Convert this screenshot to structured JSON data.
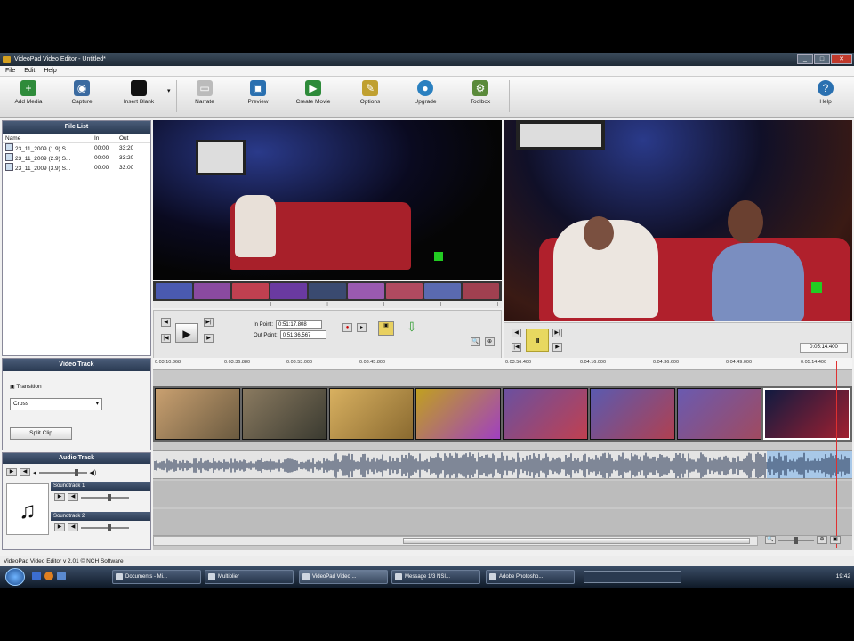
{
  "window": {
    "title": "VideoPad Video Editor - Untitled*"
  },
  "menu": [
    "File",
    "Edit",
    "Help"
  ],
  "toolbar": [
    {
      "label": "Add Media",
      "icon": "film-plus-icon",
      "color": "#2e8b3a"
    },
    {
      "label": "Capture",
      "icon": "camera-icon",
      "color": "#3a6aa0"
    },
    {
      "label": "Insert Blank",
      "icon": "black-slide-icon",
      "color": "#111111"
    },
    {
      "label": "Narrate",
      "icon": "microphone-icon",
      "color": "#999999"
    },
    {
      "label": "Preview",
      "icon": "monitor-icon",
      "color": "#2a70b0"
    },
    {
      "label": "Create Movie",
      "icon": "film-reel-icon",
      "color": "#2e8b3a"
    },
    {
      "label": "Options",
      "icon": "options-icon",
      "color": "#c0a030"
    },
    {
      "label": "Upgrade",
      "icon": "globe-icon",
      "color": "#2a80c0"
    },
    {
      "label": "Toolbox",
      "icon": "toolbox-icon",
      "color": "#5a8a3a"
    },
    {
      "label": "Help",
      "icon": "help-icon",
      "color": "#2a70b0"
    }
  ],
  "file_list": {
    "title": "File List",
    "columns": [
      "Name",
      "In",
      "Out"
    ],
    "rows": [
      {
        "name": "23_11_2009 (1.9) S...",
        "in": "00:00",
        "out": "33:20"
      },
      {
        "name": "23_11_2009 (2.9) S...",
        "in": "00:00",
        "out": "33:20"
      },
      {
        "name": "23_11_2009 (3.9) S...",
        "in": "00:00",
        "out": "33:00"
      }
    ]
  },
  "video_track": {
    "title": "Video Track",
    "transition_label": "Transition",
    "transition_value": "Cross",
    "split_button": "Split Clip"
  },
  "audio_track": {
    "title": "Audio Track",
    "soundtrack1": "Soundtrack 1",
    "soundtrack2": "Soundtrack 2"
  },
  "clip_controls": {
    "in_label": "In Point:",
    "in_value": "0:51:17.808",
    "out_label": "Out Point:",
    "out_value": "0:51:36.567"
  },
  "sequence": {
    "timecode": "0:05:14.400"
  },
  "ruler": [
    "0:03:10.368",
    "0:03:36.880",
    "0:03:53.000",
    "0:03:45.800",
    "0:03:56.400",
    "0:04:16.000",
    "0:04:36.600",
    "0:04:49.000",
    "0:05:14.400"
  ],
  "status": {
    "text": "VideoPad Video Editor v 2.01 © NCH Software"
  },
  "taskbar": {
    "tasks": [
      "Documents - Mi...",
      "Multiplier",
      "VideoPad Video ...",
      "Message 1/3 NSI...",
      "Adobe Photosho..."
    ],
    "clock": "19:42"
  }
}
